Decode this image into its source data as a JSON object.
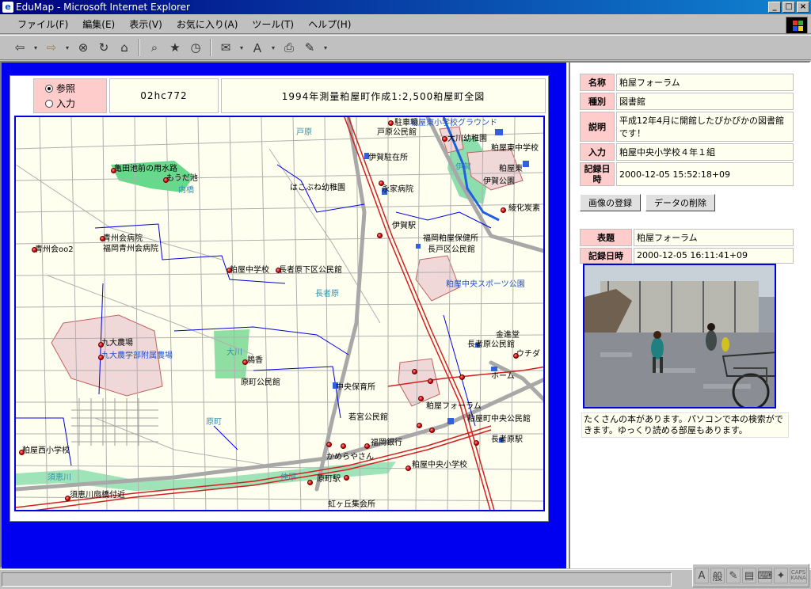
{
  "window": {
    "title": "EduMap - Microsoft Internet Explorer",
    "min": "_",
    "max": "□",
    "close": "×"
  },
  "menu": [
    "ファイル(F)",
    "編集(E)",
    "表示(V)",
    "お気に入り(A)",
    "ツール(T)",
    "ヘルプ(H)"
  ],
  "map_header": {
    "radio_ref": "参照",
    "radio_input": "入力",
    "code": "02hc772",
    "title": "1994年測量粕屋町作成1:2,500粕屋町全図"
  },
  "map_labels": {
    "l1": "粕屋東小学校グラウンド",
    "l2": "戸原公民館",
    "l3": "戸原",
    "l4": "大川幼稚園",
    "l5": "粕屋東中学校",
    "l6": "伊賀駐在所",
    "l7": "亀田池前の用水路",
    "l8": "もうだ池",
    "l9": "内橋",
    "l10": "はこぶね幼稚園",
    "l11": "伊賀公園",
    "l12": "永家病院",
    "l13": "綾化炭素",
    "l14": "伊賀駅",
    "l15": "青州会病院",
    "l16": "福岡青州会病院",
    "l17": "青州会oo2",
    "l18": "福岡粕屋保健所",
    "l19": "長戸区公民館",
    "l20": "粕屋中学校",
    "l21": "長者原下区公民館",
    "l22": "粕屋中央スポーツ公園",
    "l23": "長者原",
    "l24": "九大農場",
    "l25": "九大農学部附属農場",
    "l26": "大川",
    "l27": "鵜香",
    "l28": "原町公民館",
    "l29": "中央保育所",
    "l30": "長者原公民館",
    "l31": "金進堂",
    "l32": "ウチダ",
    "l33": "粕屋フォーラム",
    "l34": "若宮公民館",
    "l35": "粕屋町中央公民館",
    "l36": "長者原駅",
    "l37": "原町",
    "l38": "粕屋西小学校",
    "l39": "須恵川",
    "l40": "かめらやさん",
    "l41": "仲原",
    "l42": "福岡銀行",
    "l43": "粕屋中央小学校",
    "l44": "原町駅",
    "l45": "須恵川扇橋付近",
    "l46": "虹ヶ丘集会所",
    "l47": "伊賀",
    "l48": "粕屋東",
    "l49": "ホーム",
    "l50": "駐車場"
  },
  "record": {
    "name_k": "名称",
    "name_v": "粕屋フォーラム",
    "type_k": "種別",
    "type_v": "図書館",
    "desc_k": "説明",
    "desc_v": "平成12年4月に開館したぴかぴかの図書館です！",
    "input_k": "入力",
    "input_v": "粕屋中央小学校４年１組",
    "date_k": "記録日時",
    "date_v": "2000-12-05 15:52:18+09"
  },
  "buttons": {
    "register_image": "画像の登録",
    "delete_data": "データの削除"
  },
  "image_record": {
    "title_k": "表題",
    "title_v": "粕屋フォーラム",
    "date_k": "記録日時",
    "date_v": "2000-12-05 16:11:41+09",
    "caption": "たくさんの本があります。パソコンで本の検索ができます。ゆっくり読める部屋もあります。"
  },
  "ime": {
    "a": "A",
    "kan": "般",
    "caps": "CAPS KANA"
  }
}
